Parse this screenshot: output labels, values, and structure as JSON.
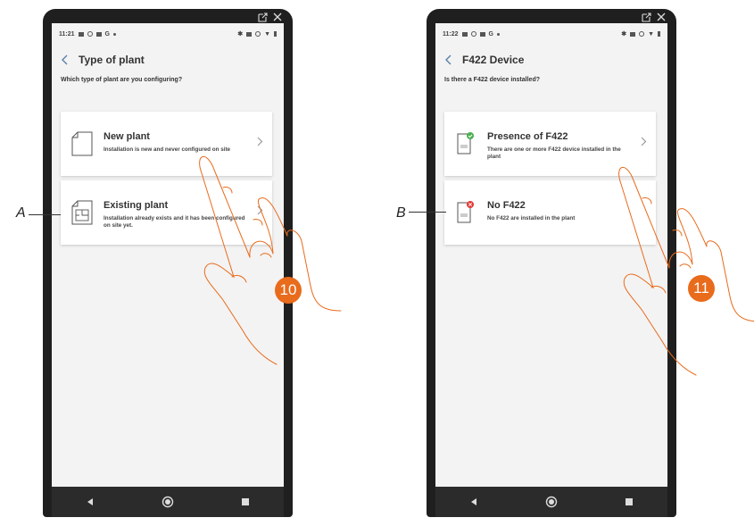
{
  "left_screen": {
    "time": "11:21",
    "status_g": "G",
    "title": "Type of plant",
    "question": "Which type of plant are you configuring?",
    "cards": [
      {
        "title": "New plant",
        "description": "Installation is new and never configured on site"
      },
      {
        "title": "Existing plant",
        "description": "Installation already exists and it has been configured on site yet."
      }
    ]
  },
  "right_screen": {
    "time": "11:22",
    "status_g": "G",
    "title": "F422 Device",
    "question": "Is there a F422 device installed?",
    "cards": [
      {
        "title": "Presence of F422",
        "description": "There are one or more F422 device installed in the plant"
      },
      {
        "title": "No F422",
        "description": "No F422 are installed in the plant"
      }
    ]
  },
  "annotations": {
    "label_a": "A",
    "label_b": "B",
    "step_left": "10",
    "step_right": "11"
  },
  "colors": {
    "accent_orange": "#e96b1c",
    "chevron_blue": "#5b7fa8",
    "status_green": "#4caf50",
    "status_red": "#e53935"
  },
  "icons": {
    "back": "chevron-left-icon",
    "forward": "chevron-right-icon",
    "new_plant": "blank-document-icon",
    "existing_plant": "floor-plan-document-icon",
    "f422_present": "device-check-icon",
    "f422_absent": "device-cross-icon"
  }
}
